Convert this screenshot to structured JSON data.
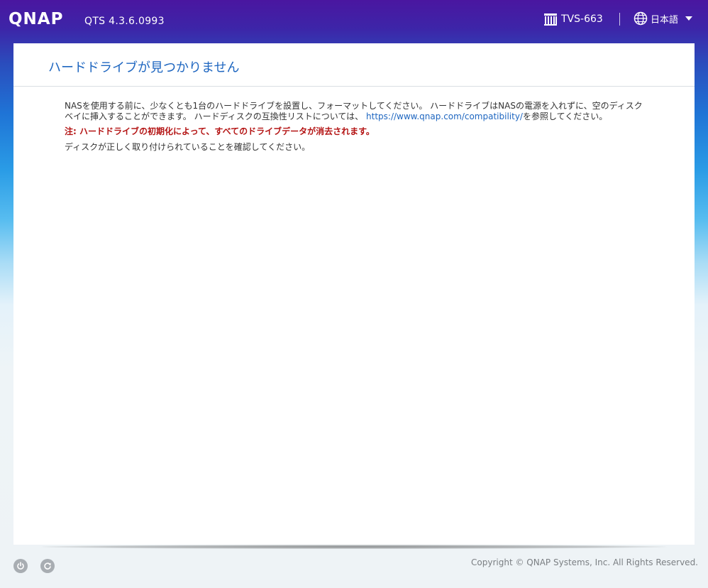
{
  "header": {
    "logo_text": "QNAP",
    "version": "QTS 4.3.6.0993",
    "device_name": "TVS-663",
    "language": "日本語",
    "icons": [
      "nas-device-icon",
      "globe-icon",
      "caret-down-icon"
    ]
  },
  "main": {
    "title": "ハードドライブが見つかりません",
    "intro_before_link": "NASを使用する前に、少なくとも1台のハードドライブを設置し、フォーマットしてください。 ハードドライブはNASの電源を入れずに、空のディスクベイに挿入することができます。 ハードディスクの互換性リストについては、",
    "link": "https://www.qnap.com/compatibility/",
    "intro_after_link": "を参照してください。",
    "warning": "注: ハードドライブの初期化によって、すべてのドライブデータが消去されます。",
    "check": "ディスクが正しく取り付けられていることを確認してください。"
  },
  "footer": {
    "icons": [
      "power-icon",
      "restart-icon"
    ],
    "copyright": "Copyright © QNAP Systems, Inc. All Rights Reserved."
  },
  "colors": {
    "title": "#1e66c0",
    "link": "#1e66c0",
    "warning": "#b41414",
    "header_top": "#4a16a0",
    "header_bottom": "#2a4dbd"
  }
}
